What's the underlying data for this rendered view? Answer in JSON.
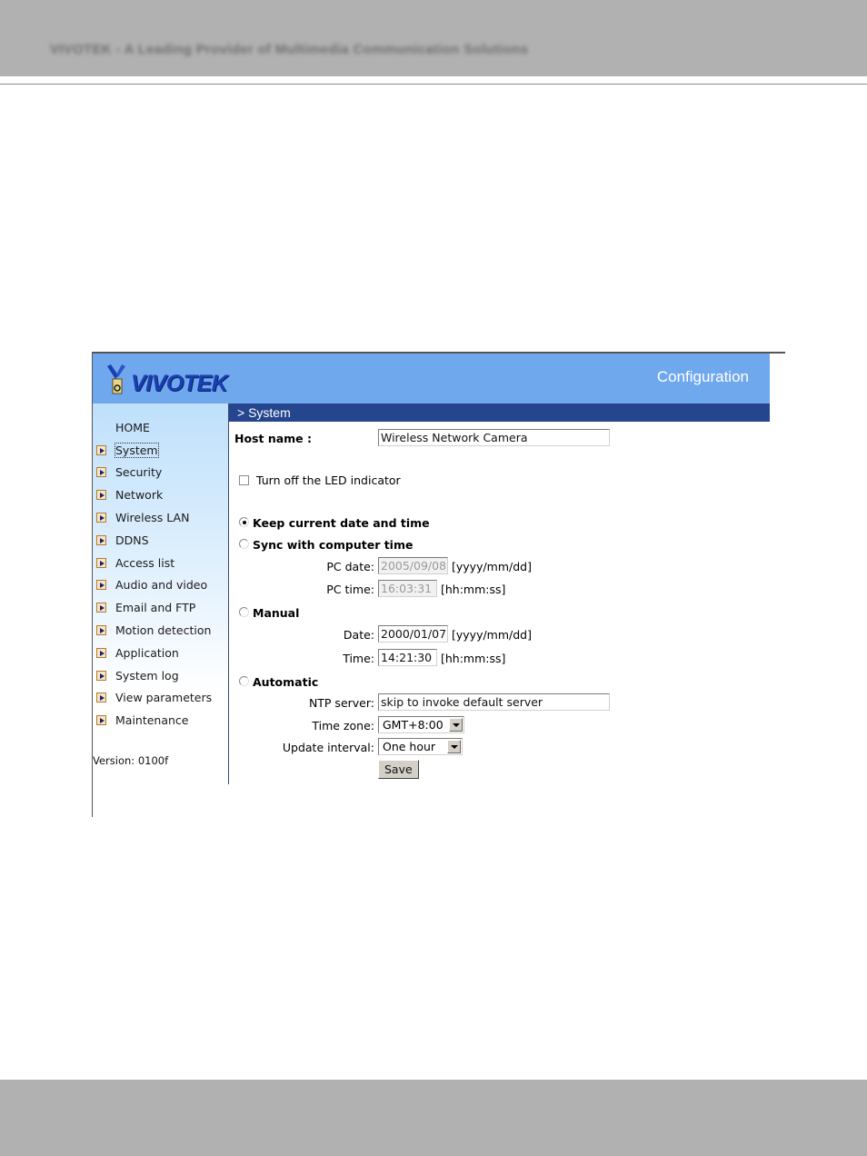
{
  "document_header": {
    "text": "VIVOTEK - A Leading Provider of Multimedia Communication Solutions"
  },
  "app": {
    "brand": "VIVOTEK",
    "title": "Configuration",
    "section_title": "> System",
    "colors": {
      "header_bg": "#70a8ee",
      "section_bar": "#25468e",
      "sidebar_top": "#bfe0fb"
    }
  },
  "sidebar": {
    "home": "HOME",
    "items": [
      {
        "label": "System",
        "active": true
      },
      {
        "label": "Security"
      },
      {
        "label": "Network"
      },
      {
        "label": "Wireless LAN"
      },
      {
        "label": "DDNS"
      },
      {
        "label": "Access list"
      },
      {
        "label": "Audio and video"
      },
      {
        "label": "Email and FTP"
      },
      {
        "label": "Motion detection"
      },
      {
        "label": "Application"
      },
      {
        "label": "System log"
      },
      {
        "label": "View parameters"
      },
      {
        "label": "Maintenance"
      }
    ],
    "version": "Version: 0100f"
  },
  "form": {
    "host_name_label": "Host name :",
    "host_name_value": "Wireless Network Camera",
    "led_label": "Turn off the LED indicator",
    "led_checked": false,
    "time_options": {
      "keep": "Keep current date and time",
      "sync": "Sync with computer time",
      "manual": "Manual",
      "automatic": "Automatic",
      "selected": "keep"
    },
    "pc_date_label": "PC date:",
    "pc_date_value": "2005/09/08",
    "pc_date_format": "[yyyy/mm/dd]",
    "pc_time_label": "PC time:",
    "pc_time_value": "16:03:31",
    "pc_time_format": "[hh:mm:ss]",
    "date_label": "Date:",
    "date_value": "2000/01/07",
    "date_format": "[yyyy/mm/dd]",
    "time_label": "Time:",
    "time_value": "14:21:30",
    "time_format": "[hh:mm:ss]",
    "ntp_label": "NTP server:",
    "ntp_value": "skip to invoke default server",
    "timezone_label": "Time zone:",
    "timezone_value": "GMT+8:00",
    "interval_label": "Update interval:",
    "interval_value": "One hour",
    "save_label": "Save"
  }
}
